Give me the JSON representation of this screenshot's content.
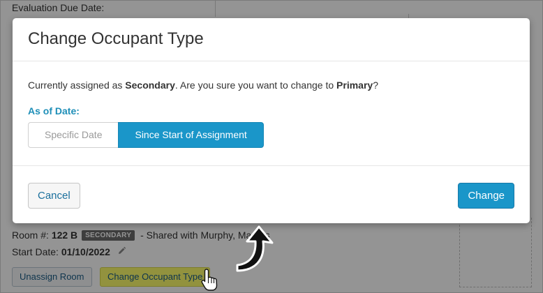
{
  "background": {
    "eval_due_label": "Evaluation Due Date:",
    "room_label": "Room #:",
    "room_number": "122 B",
    "room_badge": "SECONDARY",
    "shared_text": "- Shared with Murphy, Marcus",
    "start_label": "Start Date:",
    "start_date": "01/10/2022",
    "unassign_label": "Unassign Room",
    "change_type_label": "Change Occupant Type",
    "pencil_icon": "pencil-icon"
  },
  "modal": {
    "title": "Change Occupant Type",
    "message_prefix": "Currently assigned as ",
    "current_type": "Secondary",
    "message_middle": ". Are you sure you want to change to ",
    "new_type": "Primary",
    "message_suffix": "?",
    "as_of_label": "As of Date:",
    "option_specific": "Specific Date",
    "option_since_start": "Since Start of Assignment",
    "selected_option": "Since Start of Assignment",
    "cancel_label": "Cancel",
    "change_label": "Change"
  },
  "colors": {
    "accent": "#1a96c9",
    "label_accent": "#1f8fb8",
    "highlight": "#fbfb6c",
    "badge": "#6b6b6b"
  },
  "annotations": {
    "arrow_icon": "curved-arrow-icon",
    "cursor_icon": "hand-pointer-icon"
  }
}
